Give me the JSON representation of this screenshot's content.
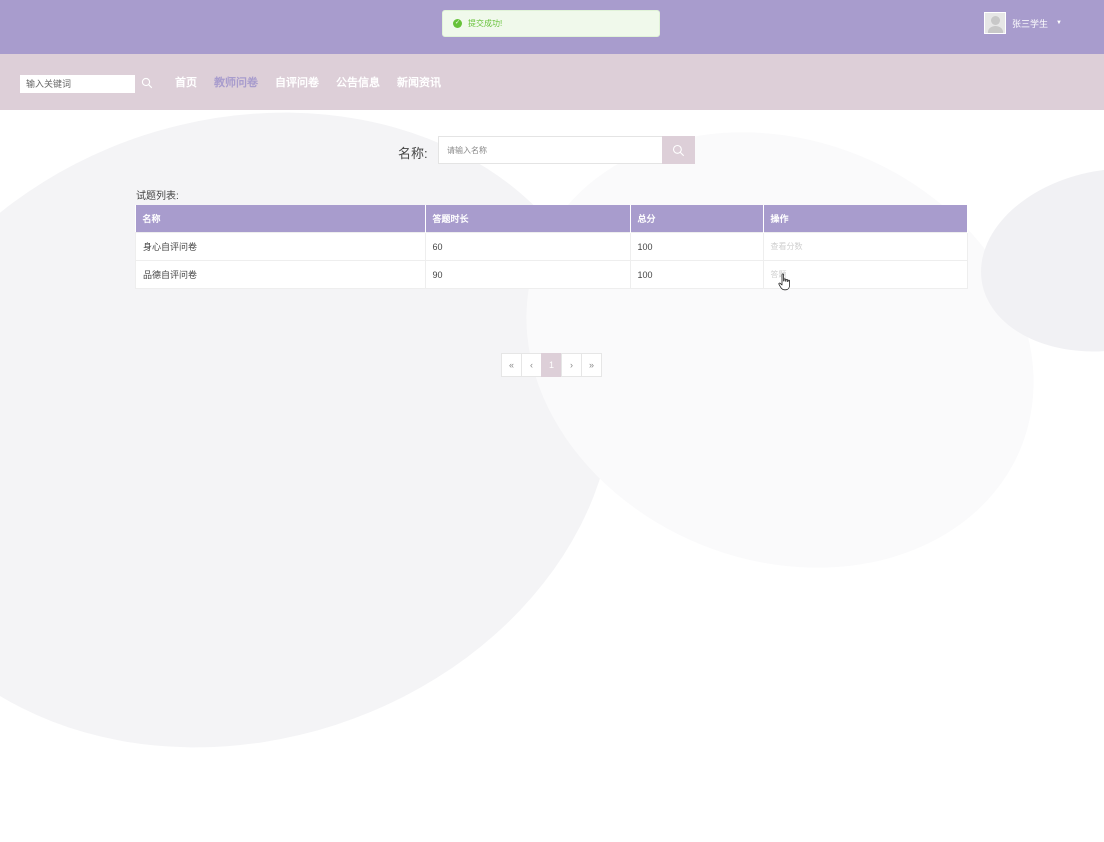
{
  "toast": {
    "message": "提交成功!"
  },
  "user": {
    "name": "张三学生"
  },
  "nav": {
    "search_placeholder": "输入关键词",
    "items": [
      {
        "label": "首页",
        "active": false
      },
      {
        "label": "教师问卷",
        "active": true
      },
      {
        "label": "自评问卷",
        "active": false
      },
      {
        "label": "公告信息",
        "active": false
      },
      {
        "label": "新闻资讯",
        "active": false
      }
    ]
  },
  "filter": {
    "label": "名称:",
    "placeholder": "请输入名称"
  },
  "list": {
    "title": "试题列表:",
    "columns": [
      "名称",
      "答题时长",
      "总分",
      "操作"
    ],
    "rows": [
      {
        "name": "身心自评问卷",
        "duration": "60",
        "score": "100",
        "action": "查看分数"
      },
      {
        "name": "品德自评问卷",
        "duration": "90",
        "score": "100",
        "action": "答题"
      }
    ]
  },
  "pagination": {
    "first": "«",
    "prev": "‹",
    "current": "1",
    "next": "›",
    "last": "»"
  },
  "colors": {
    "header": "#a89ccd",
    "nav": "#ddcfd8",
    "success": "#67c23a"
  }
}
